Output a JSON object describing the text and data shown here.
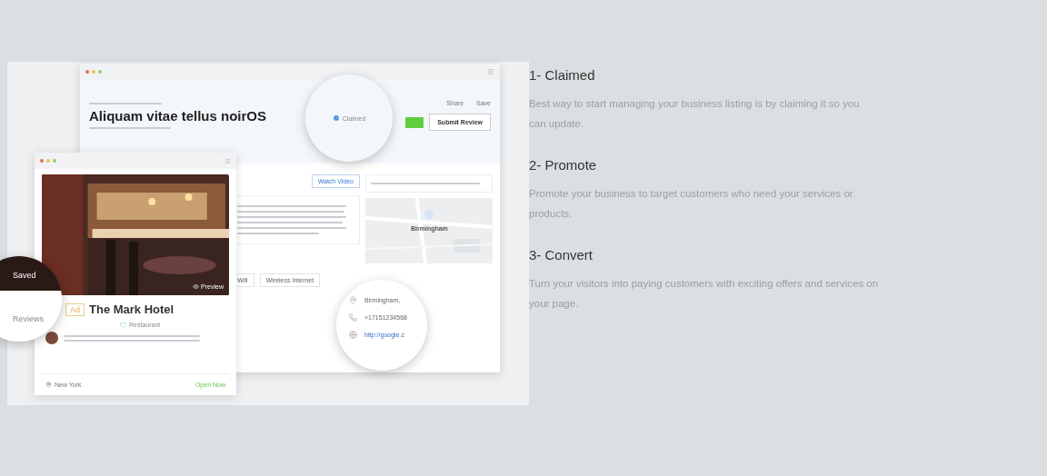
{
  "mockup": {
    "listing": {
      "title": "Aliquam vitae tellus noirOS",
      "badge": "Claimed",
      "actions": [
        "Share",
        "Save"
      ],
      "submit": "Submit Review",
      "video": "Watch Video",
      "amenities": [
        "Wifi",
        "Wireless Internet"
      ],
      "map_label": "Birmingham",
      "contact": [
        {
          "kind": "location",
          "text": "Birmingham,"
        },
        {
          "kind": "phone",
          "text": "+17151234568"
        },
        {
          "kind": "website",
          "text": "http://google.c"
        }
      ]
    },
    "card": {
      "saved": "Saved",
      "preview": "Preview",
      "ad": "Ad",
      "title": "The Mark Hotel",
      "reviews": "Reviews",
      "category": "Restaurant",
      "location": "New York",
      "status": "Open Now"
    }
  },
  "steps": [
    {
      "title": "1- Claimed",
      "text": "Best way to start managing your business listing is by claiming it so you can update."
    },
    {
      "title": "2- Promote",
      "text": "Promote your business to target customers who need your services or products."
    },
    {
      "title": "3- Convert",
      "text": "Turn your visitors into paying customers with exciting offers and services on your page."
    }
  ]
}
